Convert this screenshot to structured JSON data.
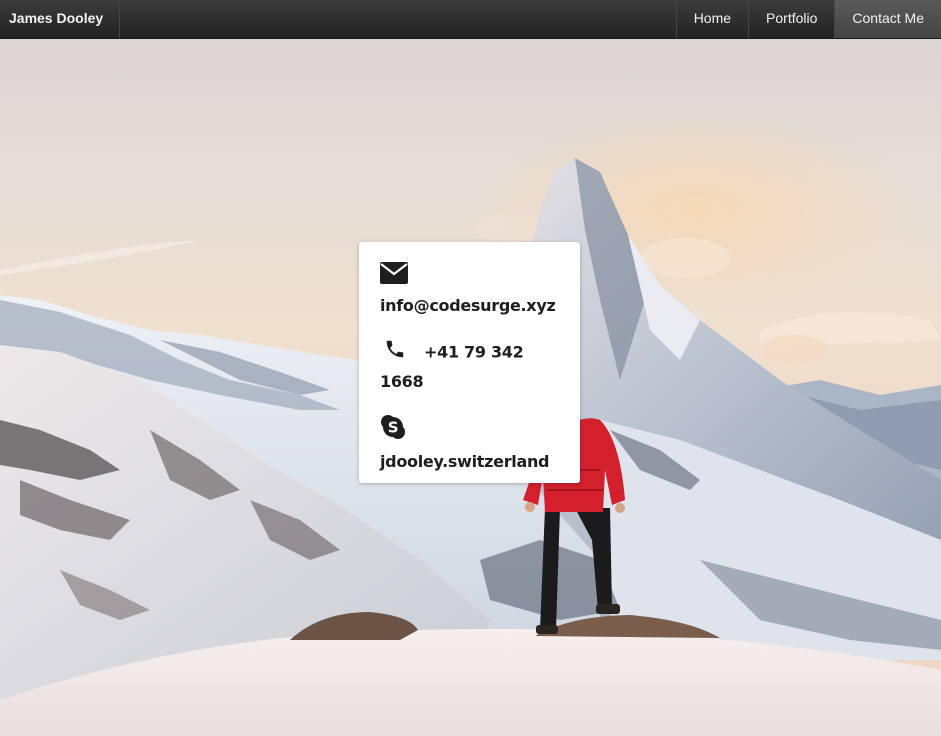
{
  "nav": {
    "brand": "James Dooley",
    "items": [
      {
        "label": "Home"
      },
      {
        "label": "Portfolio"
      },
      {
        "label": "Contact Me"
      }
    ],
    "active": "Contact Me"
  },
  "contact": {
    "email": "info@codesurge.xyz",
    "phone": "+41 79 342 1668",
    "skype": "jdooley.switzerland"
  },
  "icons": {
    "email": "envelope-icon",
    "phone": "phone-icon",
    "skype": "skype-icon"
  },
  "colors": {
    "navbar": "#2f2f2f",
    "nav_active": "#4f4f4f",
    "card": "#ffffff",
    "text": "#1e1e1e"
  }
}
